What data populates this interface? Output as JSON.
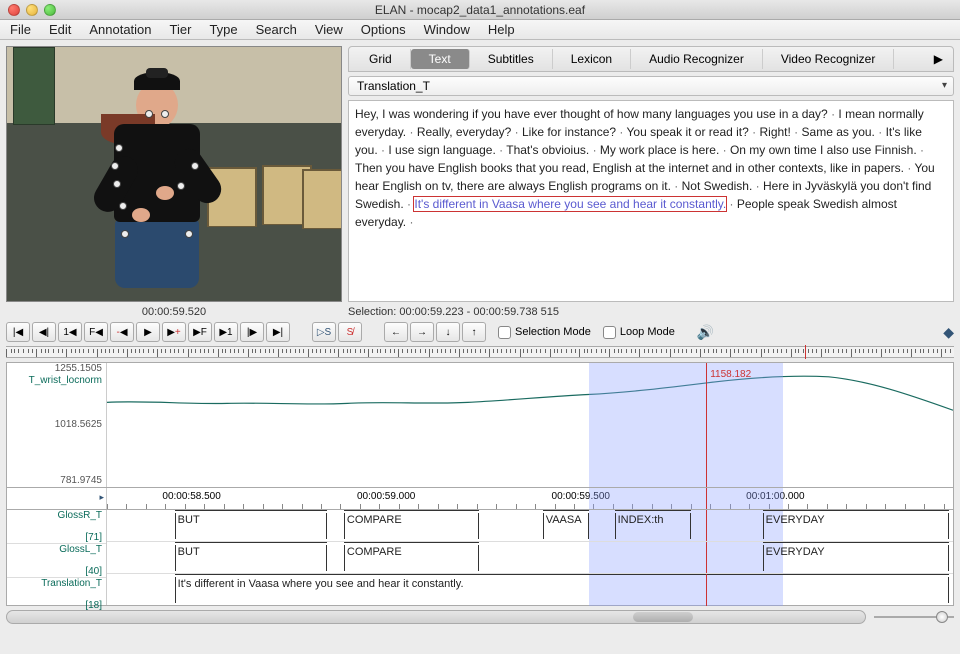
{
  "window": {
    "title": "ELAN - mocap2_data1_annotations.eaf"
  },
  "menu": [
    "File",
    "Edit",
    "Annotation",
    "Tier",
    "Type",
    "Search",
    "View",
    "Options",
    "Window",
    "Help"
  ],
  "video": {
    "timecode": "00:00:59.520"
  },
  "tabs": {
    "items": [
      "Grid",
      "Text",
      "Subtitles",
      "Lexicon",
      "Audio Recognizer",
      "Video Recognizer"
    ],
    "active_index": 1
  },
  "tier_select": "Translation_T",
  "text_sentences": [
    "Hey, I was wondering if you have ever thought of how many languages you use in a day?",
    "I mean normally everyday.",
    "Really, everyday?",
    "Like for instance?",
    "You speak it or read it?",
    "Right!",
    "Same as you.",
    "It's like you.",
    "I use sign language.",
    "That's obvioius.",
    "My work place is here.",
    "On my own time I also use Finnish.",
    "Then you have English books that you read, English at the internet and in other contexts, like in papers.",
    "You hear English on tv, there are always English programs on it.",
    "Not Swedish.",
    "Here in Jyväskylä you don't find Swedish.",
    "It's different in Vaasa where you see and hear it constantly.",
    "People speak Swedish almost everyday."
  ],
  "highlight_index": 16,
  "selection_info": "Selection: 00:00:59.223 - 00:00:59.738  515",
  "controls": {
    "selection_mode": "Selection Mode",
    "loop_mode": "Loop Mode"
  },
  "thin_ruler_playhead_pct": 84.3,
  "waveform": {
    "tier": "T_wrist_locnorm",
    "y_ticks": [
      "1255.1505",
      "1018.5625",
      "781.9745"
    ],
    "value_at_cursor": "1158.182",
    "sel_start_pct": 57.0,
    "sel_end_pct": 79.9,
    "playhead_pct": 70.8
  },
  "time_scale": {
    "labels": [
      {
        "pct": 10,
        "text": "00:00:58.500"
      },
      {
        "pct": 33,
        "text": "00:00:59.000"
      },
      {
        "pct": 56,
        "text": "00:00:59.500"
      },
      {
        "pct": 79,
        "text": "00:01:00.000"
      }
    ],
    "sel_start_pct": 57.0,
    "sel_end_pct": 79.9,
    "playhead_pct": 70.8
  },
  "anno_tiers": [
    {
      "name": "GlossR_T",
      "count": "[71]",
      "segs": [
        {
          "start_pct": 8,
          "end_pct": 26,
          "text": "BUT"
        },
        {
          "start_pct": 28,
          "end_pct": 44,
          "text": "COMPARE"
        },
        {
          "start_pct": 51.5,
          "end_pct": 57,
          "text": "VAASA"
        },
        {
          "start_pct": 60,
          "end_pct": 69,
          "text": "INDEX:th"
        },
        {
          "start_pct": 77.5,
          "end_pct": 99.5,
          "text": "EVERYDAY"
        }
      ]
    },
    {
      "name": "GlossL_T",
      "count": "[40]",
      "segs": [
        {
          "start_pct": 8,
          "end_pct": 26,
          "text": "BUT"
        },
        {
          "start_pct": 28,
          "end_pct": 44,
          "text": "COMPARE"
        },
        {
          "start_pct": 77.5,
          "end_pct": 99.5,
          "text": "EVERYDAY"
        }
      ]
    },
    {
      "name": "Translation_T",
      "count": "[18]",
      "segs": [
        {
          "start_pct": 8,
          "end_pct": 99.5,
          "text": "It's different in Vaasa where you see and hear it constantly."
        }
      ]
    }
  ],
  "anno_sel": {
    "start_pct": 57.0,
    "end_pct": 79.9,
    "playhead_pct": 70.8
  },
  "hscroll": {
    "thumb_left_pct": 73,
    "thumb_width_pct": 7
  },
  "zoom_knob_pct": 78
}
